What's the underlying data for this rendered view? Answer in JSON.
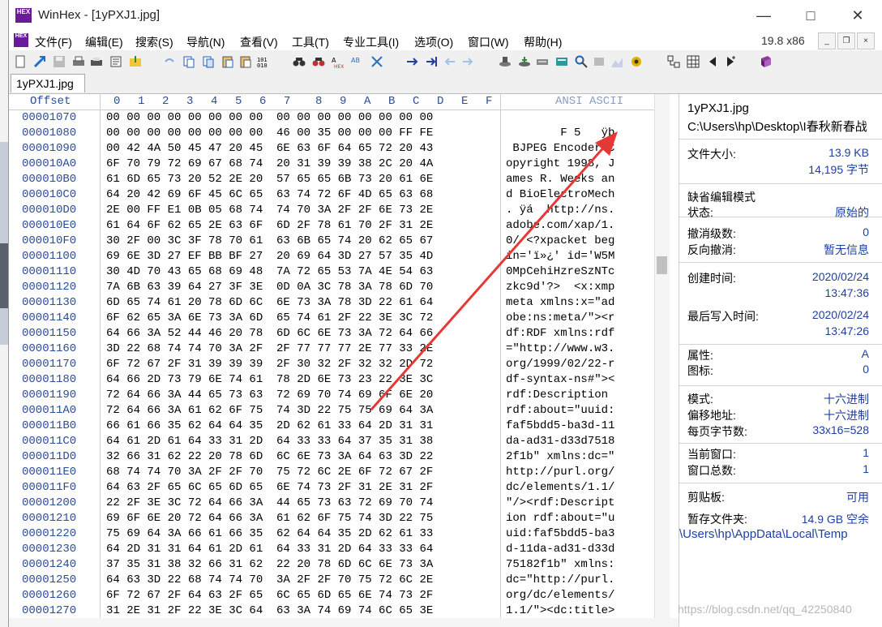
{
  "window": {
    "title": "WinHex - [1yPXJ1.jpg]",
    "icon_label": "HEX"
  },
  "menu": {
    "items": [
      "文件(F)",
      "编辑(E)",
      "搜索(S)",
      "导航(N)",
      "查看(V)",
      "工具(T)",
      "专业工具(I)",
      "选项(O)",
      "窗口(W)",
      "帮助(H)"
    ],
    "version": "19.8 x86"
  },
  "tab": {
    "label": "1yPXJ1.jpg"
  },
  "hex": {
    "header_offset": "Offset",
    "header_cols": [
      "0",
      "1",
      "2",
      "3",
      "4",
      "5",
      "6",
      "7",
      "8",
      "9",
      "A",
      "B",
      "C",
      "D",
      "E",
      "F"
    ],
    "header_ascii": "ANSI ASCII",
    "rows": [
      {
        "off": "00001070",
        "hex": "00 00 00 00 00 00 00 00  00 00 00 00 00 00 00 00",
        "asc": ""
      },
      {
        "off": "00001080",
        "hex": "00 00 00 00 00 00 00 00  46 00 35 00 00 00 FF FE",
        "asc": "        F 5   ÿþ"
      },
      {
        "off": "00001090",
        "hex": "00 42 4A 50 45 47 20 45  6E 63 6F 64 65 72 20 43",
        "asc": " BJPEG Encoder C"
      },
      {
        "off": "000010A0",
        "hex": "6F 70 79 72 69 67 68 74  20 31 39 39 38 2C 20 4A",
        "asc": "opyright 1998, J"
      },
      {
        "off": "000010B0",
        "hex": "61 6D 65 73 20 52 2E 20  57 65 65 6B 73 20 61 6E",
        "asc": "ames R. Weeks an"
      },
      {
        "off": "000010C0",
        "hex": "64 20 42 69 6F 45 6C 65  63 74 72 6F 4D 65 63 68",
        "asc": "d BioElectroMech"
      },
      {
        "off": "000010D0",
        "hex": "2E 00 FF E1 0B 05 68 74  74 70 3A 2F 2F 6E 73 2E",
        "asc": ". ÿá  http://ns."
      },
      {
        "off": "000010E0",
        "hex": "61 64 6F 62 65 2E 63 6F  6D 2F 78 61 70 2F 31 2E",
        "asc": "adobe.com/xap/1."
      },
      {
        "off": "000010F0",
        "hex": "30 2F 00 3C 3F 78 70 61  63 6B 65 74 20 62 65 67",
        "asc": "0/ <?xpacket beg"
      },
      {
        "off": "00001100",
        "hex": "69 6E 3D 27 EF BB BF 27  20 69 64 3D 27 57 35 4D",
        "asc": "in='ï»¿' id='W5M"
      },
      {
        "off": "00001110",
        "hex": "30 4D 70 43 65 68 69 48  7A 72 65 53 7A 4E 54 63",
        "asc": "0MpCehiHzreSzNTc"
      },
      {
        "off": "00001120",
        "hex": "7A 6B 63 39 64 27 3F 3E  0D 0A 3C 78 3A 78 6D 70",
        "asc": "zkc9d'?>  <x:xmp"
      },
      {
        "off": "00001130",
        "hex": "6D 65 74 61 20 78 6D 6C  6E 73 3A 78 3D 22 61 64",
        "asc": "meta xmlns:x=\"ad"
      },
      {
        "off": "00001140",
        "hex": "6F 62 65 3A 6E 73 3A 6D  65 74 61 2F 22 3E 3C 72",
        "asc": "obe:ns:meta/\"><r"
      },
      {
        "off": "00001150",
        "hex": "64 66 3A 52 44 46 20 78  6D 6C 6E 73 3A 72 64 66",
        "asc": "df:RDF xmlns:rdf"
      },
      {
        "off": "00001160",
        "hex": "3D 22 68 74 74 70 3A 2F  2F 77 77 77 2E 77 33 2E",
        "asc": "=\"http://www.w3."
      },
      {
        "off": "00001170",
        "hex": "6F 72 67 2F 31 39 39 39  2F 30 32 2F 32 32 2D 72",
        "asc": "org/1999/02/22-r"
      },
      {
        "off": "00001180",
        "hex": "64 66 2D 73 79 6E 74 61  78 2D 6E 73 23 22 3E 3C",
        "asc": "df-syntax-ns#\"><"
      },
      {
        "off": "00001190",
        "hex": "72 64 66 3A 44 65 73 63  72 69 70 74 69 6F 6E 20",
        "asc": "rdf:Description "
      },
      {
        "off": "000011A0",
        "hex": "72 64 66 3A 61 62 6F 75  74 3D 22 75 75 69 64 3A",
        "asc": "rdf:about=\"uuid:"
      },
      {
        "off": "000011B0",
        "hex": "66 61 66 35 62 64 64 35  2D 62 61 33 64 2D 31 31",
        "asc": "faf5bdd5-ba3d-11"
      },
      {
        "off": "000011C0",
        "hex": "64 61 2D 61 64 33 31 2D  64 33 33 64 37 35 31 38",
        "asc": "da-ad31-d33d7518"
      },
      {
        "off": "000011D0",
        "hex": "32 66 31 62 22 20 78 6D  6C 6E 73 3A 64 63 3D 22",
        "asc": "2f1b\" xmlns:dc=\""
      },
      {
        "off": "000011E0",
        "hex": "68 74 74 70 3A 2F 2F 70  75 72 6C 2E 6F 72 67 2F",
        "asc": "http://purl.org/"
      },
      {
        "off": "000011F0",
        "hex": "64 63 2F 65 6C 65 6D 65  6E 74 73 2F 31 2E 31 2F",
        "asc": "dc/elements/1.1/"
      },
      {
        "off": "00001200",
        "hex": "22 2F 3E 3C 72 64 66 3A  44 65 73 63 72 69 70 74",
        "asc": "\"/><rdf:Descript"
      },
      {
        "off": "00001210",
        "hex": "69 6F 6E 20 72 64 66 3A  61 62 6F 75 74 3D 22 75",
        "asc": "ion rdf:about=\"u"
      },
      {
        "off": "00001220",
        "hex": "75 69 64 3A 66 61 66 35  62 64 64 35 2D 62 61 33",
        "asc": "uid:faf5bdd5-ba3"
      },
      {
        "off": "00001230",
        "hex": "64 2D 31 31 64 61 2D 61  64 33 31 2D 64 33 33 64",
        "asc": "d-11da-ad31-d33d"
      },
      {
        "off": "00001240",
        "hex": "37 35 31 38 32 66 31 62  22 20 78 6D 6C 6E 73 3A",
        "asc": "75182f1b\" xmlns:"
      },
      {
        "off": "00001250",
        "hex": "64 63 3D 22 68 74 74 70  3A 2F 2F 70 75 72 6C 2E",
        "asc": "dc=\"http://purl."
      },
      {
        "off": "00001260",
        "hex": "6F 72 67 2F 64 63 2F 65  6C 65 6D 65 6E 74 73 2F",
        "asc": "org/dc/elements/"
      },
      {
        "off": "00001270",
        "hex": "31 2E 31 2F 22 3E 3C 64  63 3A 74 69 74 6C 65 3E",
        "asc": "1.1/\"><dc:title>"
      }
    ]
  },
  "info": {
    "filename": "1yPXJ1.jpg",
    "path": "C:\\Users\\hp\\Desktop\\I春秋新春战",
    "size_label": "文件大小:",
    "size_value": "13.9 KB",
    "size_bytes": "14,195 字节",
    "edit_mode": "缺省编辑模式",
    "state_label": "状态:",
    "state_value": "原始的",
    "undo_label": "撤消级数:",
    "undo_value": "0",
    "redo_label": "反向撤消:",
    "redo_value": "暂无信息",
    "created_label": "创建时间:",
    "created_date": "2020/02/24",
    "created_time": "13:47:36",
    "modified_label": "最后写入时间:",
    "modified_date": "2020/02/24",
    "modified_time": "13:47:26",
    "attr_label": "属性:",
    "attr_value": "A",
    "icon_label": "图标:",
    "icon_value": "0",
    "mode_label": "模式:",
    "mode_value": "十六进制",
    "offset_label": "偏移地址:",
    "offset_value": "十六进制",
    "bpp_label": "每页字节数:",
    "bpp_value": "33x16=528",
    "curwin_label": "当前窗口:",
    "curwin_value": "1",
    "totwin_label": "窗口总数:",
    "totwin_value": "1",
    "clip_label": "剪贴板:",
    "clip_value": "可用",
    "temp_label": "暂存文件夹:",
    "temp_value": "14.9 GB 空余",
    "temp_path": "\\Users\\hp\\AppData\\Local\\Temp"
  },
  "watermark": "https://blog.csdn.net/qq_42250840",
  "colors": {
    "offset_blue": "#2b4c9b",
    "info_blue": "#1f3f9f",
    "arrow_red": "#e53935"
  }
}
